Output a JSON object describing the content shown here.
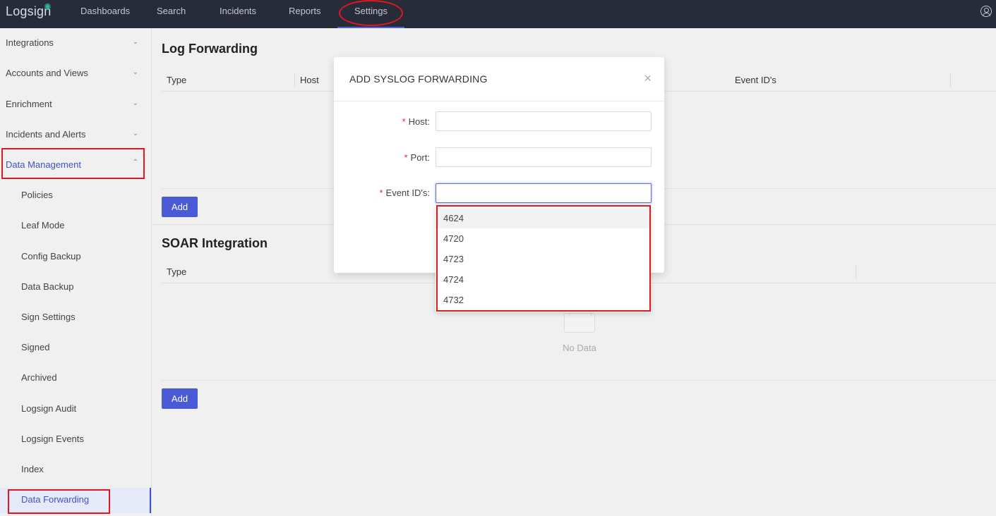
{
  "app": {
    "logo": "Logsign"
  },
  "nav": {
    "items": [
      "Dashboards",
      "Search",
      "Incidents",
      "Reports",
      "Settings"
    ]
  },
  "sidebar": {
    "groups": [
      {
        "label": "Integrations"
      },
      {
        "label": "Accounts and Views"
      },
      {
        "label": "Enrichment"
      },
      {
        "label": "Incidents and Alerts"
      },
      {
        "label": "Data Management"
      }
    ],
    "sub_items": [
      "Policies",
      "Leaf Mode",
      "Config Backup",
      "Data Backup",
      "Sign Settings",
      "Signed",
      "Archived",
      "Logsign Audit",
      "Logsign Events",
      "Index",
      "Data Forwarding"
    ]
  },
  "log_forwarding": {
    "title": "Log Forwarding",
    "columns": [
      "Type",
      "Host",
      "Event ID's"
    ],
    "add_label": "Add"
  },
  "soar": {
    "title": "SOAR Integration",
    "columns": [
      "Type"
    ],
    "empty_text": "No Data",
    "add_label": "Add"
  },
  "modal": {
    "title": "ADD SYSLOG FORWARDING",
    "close_glyph": "×",
    "required_mark": "*",
    "fields": {
      "host_label": "Host",
      "port_label": "Port",
      "event_ids_label": "Event ID's"
    },
    "label_suffix": ":"
  },
  "event_id_options": [
    "4624",
    "4720",
    "4723",
    "4724",
    "4732"
  ],
  "colors": {
    "topbar": "#272b3a",
    "accent": "#4a5ad6",
    "annotation": "#e0191c"
  }
}
